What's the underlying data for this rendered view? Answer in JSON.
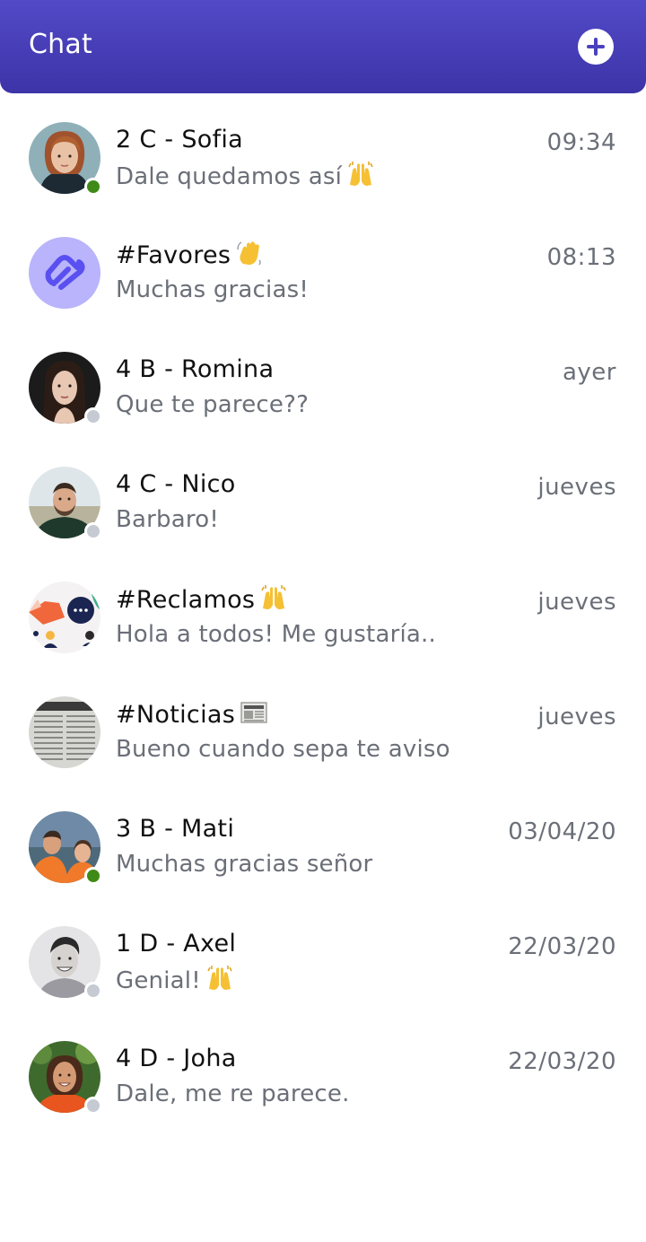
{
  "header": {
    "title": "Chat"
  },
  "chats": [
    {
      "name": "2 C - Sofia",
      "preview": "Dale quedamos así",
      "time": "09:34",
      "status": "online"
    },
    {
      "name": "#Favores",
      "preview": "Muchas gracias!",
      "time": "08:13",
      "status": "none"
    },
    {
      "name": "4 B - Romina",
      "preview": "Que te parece??",
      "time": "ayer",
      "status": "offline"
    },
    {
      "name": "4 C - Nico",
      "preview": "Barbaro!",
      "time": "jueves",
      "status": "offline"
    },
    {
      "name": "#Reclamos",
      "preview": "Hola a todos! Me gustaría..",
      "time": "jueves",
      "status": "none"
    },
    {
      "name": "#Noticias",
      "preview": "Bueno cuando sepa te aviso",
      "time": "jueves",
      "status": "none"
    },
    {
      "name": "3 B - Mati",
      "preview": "Muchas gracias señor",
      "time": "03/04/20",
      "status": "online"
    },
    {
      "name": "1 D - Axel",
      "preview": "Genial!",
      "time": "22/03/20",
      "status": "offline"
    },
    {
      "name": "4 D - Joha",
      "preview": "Dale, me re parece.",
      "time": "22/03/20",
      "status": "offline"
    }
  ],
  "colors": {
    "header_top": "#5249c7",
    "header_bottom": "#3d34a8",
    "online": "#3f8a17",
    "offline": "#c5cad3",
    "text_primary": "#111111",
    "text_secondary": "#6b6f78"
  }
}
